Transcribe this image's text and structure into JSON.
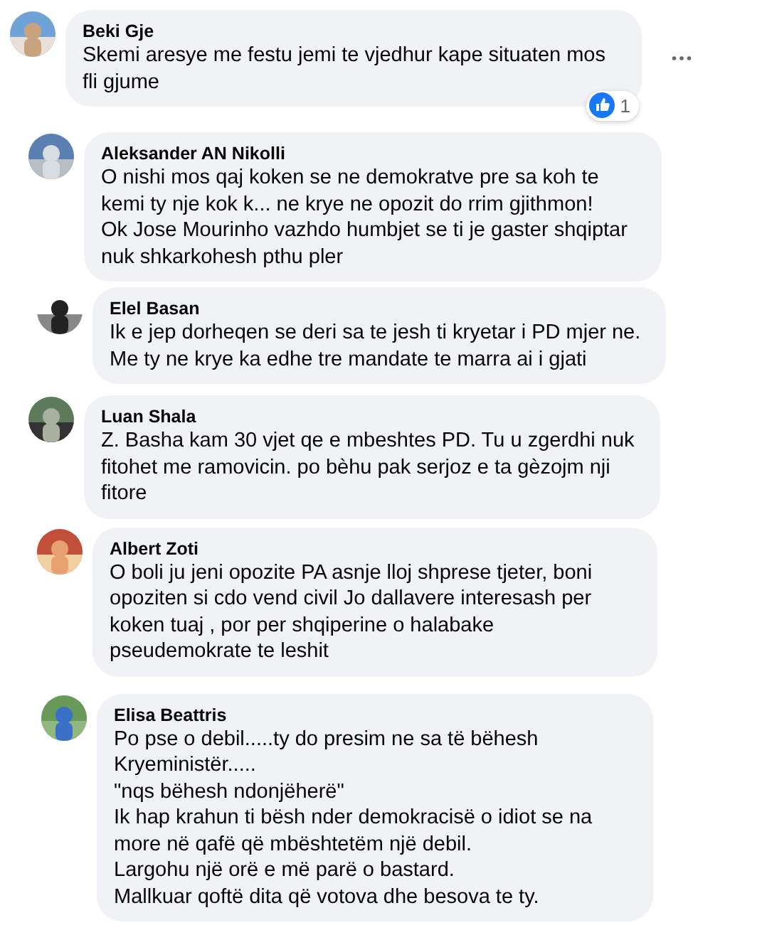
{
  "comments": [
    {
      "author": "Beki Gje",
      "text": "Skemi aresye me festu jemi te vjedhur kape situaten mos fli gjume",
      "menu_button": true,
      "reaction_count": "1"
    },
    {
      "author": "Aleksander AN Nikolli",
      "text": "O nishi mos qaj koken se ne demokratve pre sa koh te kemi ty nje kok k... ne krye ne opozit do rrim gjithmon!\nOk Jose Mourinho vazhdo humbjet se ti je gaster shqiptar nuk shkarkohesh pthu pler",
      "menu_button": false
    },
    {
      "author": "Elel Basan",
      "text": "Ik e jep dorheqen se deri sa te jesh ti kryetar i PD mjer ne. Me ty ne krye ka edhe tre mandate te marra ai i gjati",
      "menu_button": false
    },
    {
      "author": "Luan Shala",
      "text": "Z. Basha kam 30 vjet qe e mbeshtes PD. Tu u zgerdhi nuk fitohet me ramovicin. po bèhu pak serjoz e ta gèzojm nji fitore",
      "menu_button": false
    },
    {
      "author": "Albert Zoti",
      "text": "O boli ju jeni opozite PA asnje lloj shprese tjeter, boni opoziten si cdo vend civil Jo dallavere interesash per koken tuaj , por per shqiperine o halabake pseudemokrate te leshit",
      "menu_button": false
    },
    {
      "author": "Elisa Beattris",
      "text": "Po pse o debil.....ty do presim ne sa të bëhesh Kryeministër.....\n\"nqs bëhesh ndonjëherë\"\nIk hap krahun ti bësh nder demokracisë o idiot se na more në qafë që mbështetëm një debil.\nLargohu një orë e më parë o bastard.\nMallkuar qoftë dita që votova dhe besova te ty.",
      "menu_button": false
    }
  ]
}
